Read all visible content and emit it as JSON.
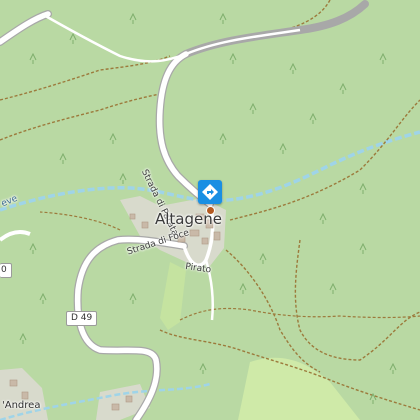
{
  "map": {
    "place_name": "Altagene",
    "roads": {
      "strada_di_parata": "Strada di Parata",
      "strada_di_foce": "Strada di Foce",
      "pirato": "Pirato"
    },
    "route_shields": {
      "d49": "D 49",
      "edge_shield": "0"
    },
    "edge_labels": {
      "eve": "eve",
      "andrea": "'Andrea"
    },
    "icons": {
      "poi_marker": "directions-diamond-icon",
      "trees": "tree-icon"
    },
    "colors": {
      "forest": "#b9d9a3",
      "meadow": "#cfeaa8",
      "road": "#ffffff",
      "road_casing": "#a8a8a8",
      "track": "#9c7a3c",
      "river": "#9fd4e8",
      "village": "#ddd9d4",
      "poi_marker": "#1a8fe3"
    }
  }
}
